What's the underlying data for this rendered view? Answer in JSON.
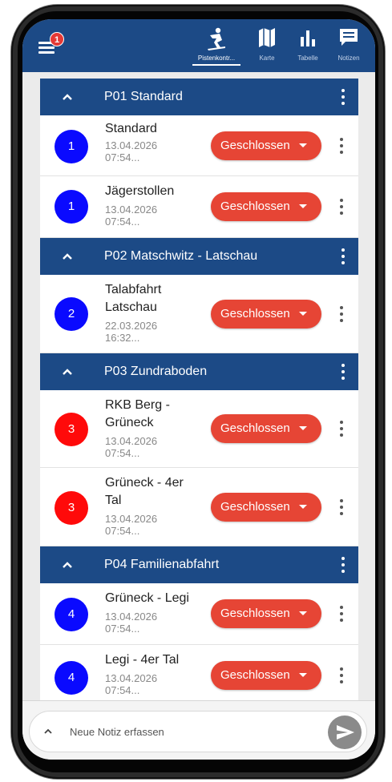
{
  "menu": {
    "badge": "1"
  },
  "tabs": [
    {
      "label": "Pistenkontr...",
      "icon": "skier-icon",
      "active": true
    },
    {
      "label": "Karte",
      "icon": "map-icon",
      "active": false
    },
    {
      "label": "Tabelle",
      "icon": "bar-chart-icon",
      "active": false
    },
    {
      "label": "Notizen",
      "icon": "note-icon",
      "active": false
    }
  ],
  "groups": [
    {
      "title": "P01 Standard",
      "items": [
        {
          "number": "1",
          "color": "#0a0aff",
          "name": "Standard",
          "date": "13.04.2026",
          "time": "07:54...",
          "status": "Geschlossen"
        },
        {
          "number": "1",
          "color": "#0a0aff",
          "name": "Jägerstollen",
          "date": "13.04.2026",
          "time": "07:54...",
          "status": "Geschlossen"
        }
      ]
    },
    {
      "title": "P02 Matschwitz - Latschau",
      "items": [
        {
          "number": "2",
          "color": "#0a0aff",
          "name": "Talabfahrt Latschau",
          "date": "22.03.2026",
          "time": "16:32...",
          "status": "Geschlossen"
        }
      ]
    },
    {
      "title": "P03 Zundraboden",
      "items": [
        {
          "number": "3",
          "color": "#ff0a0a",
          "name": "RKB Berg - Grüneck",
          "date": "13.04.2026",
          "time": "07:54...",
          "status": "Geschlossen"
        },
        {
          "number": "3",
          "color": "#ff0a0a",
          "name": "Grüneck - 4er Tal",
          "date": "13.04.2026",
          "time": "07:54...",
          "status": "Geschlossen"
        }
      ]
    },
    {
      "title": "P04 Familienabfahrt",
      "items": [
        {
          "number": "4",
          "color": "#0a0aff",
          "name": "Grüneck - Legi",
          "date": "13.04.2026",
          "time": "07:54...",
          "status": "Geschlossen"
        },
        {
          "number": "4",
          "color": "#0a0aff",
          "name": "Legi - 4er Tal",
          "date": "13.04.2026",
          "time": "07:54...",
          "status": "Geschlossen"
        }
      ]
    }
  ],
  "note": {
    "placeholder": "Neue Notiz erfassen"
  },
  "colors": {
    "primary": "#1c4a86",
    "status": "#e64535",
    "send": "#8a8a8a"
  }
}
